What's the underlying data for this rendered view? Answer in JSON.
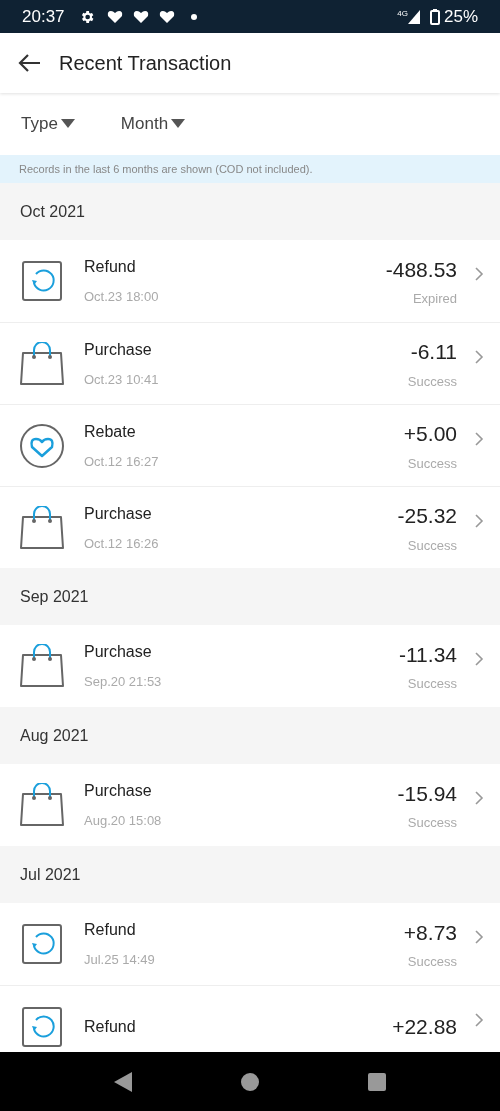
{
  "status_bar": {
    "time": "20:37",
    "network": "4G",
    "battery": "25%"
  },
  "header": {
    "title": "Recent Transaction"
  },
  "filters": [
    {
      "label": "Type"
    },
    {
      "label": "Month"
    }
  ],
  "notice": "Records in the last 6 months are shown (COD not included).",
  "sections": [
    {
      "month": "Oct 2021",
      "transactions": [
        {
          "kind": "refund",
          "title": "Refund",
          "time": "Oct.23 18:00",
          "amount": "-488.53",
          "status": "Expired"
        },
        {
          "kind": "purchase",
          "title": "Purchase",
          "time": "Oct.23 10:41",
          "amount": "-6.11",
          "status": "Success"
        },
        {
          "kind": "rebate",
          "title": "Rebate",
          "time": "Oct.12 16:27",
          "amount": "+5.00",
          "status": "Success"
        },
        {
          "kind": "purchase",
          "title": "Purchase",
          "time": "Oct.12 16:26",
          "amount": "-25.32",
          "status": "Success"
        }
      ]
    },
    {
      "month": "Sep 2021",
      "transactions": [
        {
          "kind": "purchase",
          "title": "Purchase",
          "time": "Sep.20 21:53",
          "amount": "-11.34",
          "status": "Success"
        }
      ]
    },
    {
      "month": "Aug 2021",
      "transactions": [
        {
          "kind": "purchase",
          "title": "Purchase",
          "time": "Aug.20 15:08",
          "amount": "-15.94",
          "status": "Success"
        }
      ]
    },
    {
      "month": "Jul 2021",
      "transactions": [
        {
          "kind": "refund",
          "title": "Refund",
          "time": "Jul.25 14:49",
          "amount": "+8.73",
          "status": "Success"
        },
        {
          "kind": "refund",
          "title": "Refund",
          "amount": "+22.88"
        }
      ]
    }
  ]
}
